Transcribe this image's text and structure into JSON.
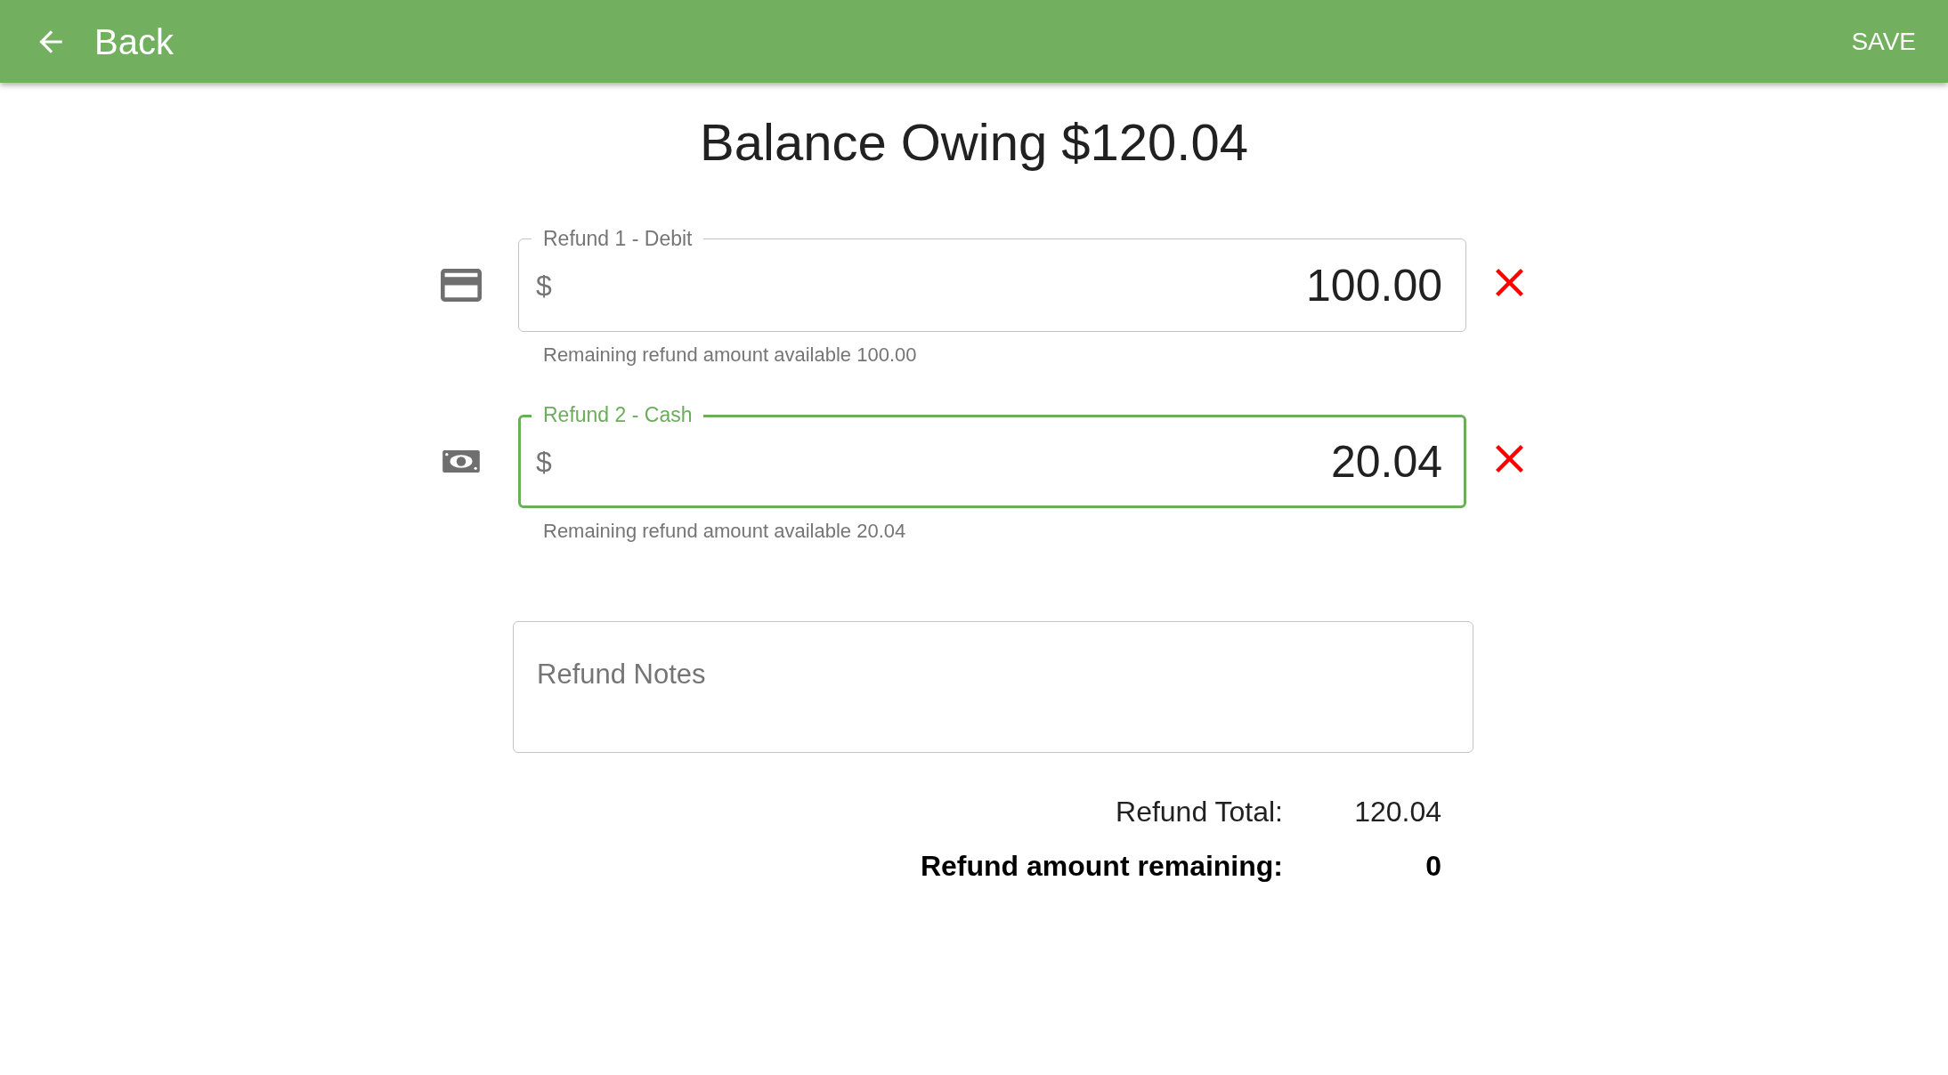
{
  "header": {
    "back_label": "Back",
    "action_label": "SAVE"
  },
  "title": "Balance Owing $120.04",
  "refunds": [
    {
      "kind": "card",
      "label": "Refund 1 - Debit",
      "currency": "$",
      "amount": "100.00",
      "helper": "Remaining refund amount available 100.00",
      "focused": false
    },
    {
      "kind": "cash",
      "label": "Refund 2 - Cash",
      "currency": "$",
      "amount": "20.04",
      "helper": "Remaining refund amount available 20.04",
      "focused": true
    }
  ],
  "notes": {
    "placeholder": "Refund Notes"
  },
  "summary": [
    {
      "label": "Refund Total:",
      "value": "120.04",
      "emphasis": false
    },
    {
      "label": "Refund amount remaining:",
      "value": "0",
      "emphasis": true
    }
  ]
}
